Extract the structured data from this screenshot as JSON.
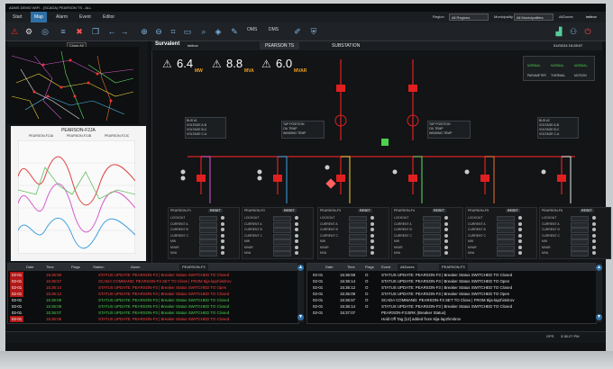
{
  "window": {
    "title": "ADMS DEMO WIFI - (SCADA) PEARSON TS - ALL"
  },
  "menu": {
    "items": [
      "Start",
      "Map",
      "Alarm",
      "Event",
      "Editor"
    ],
    "active": "Map"
  },
  "region": {
    "region_label": "Region",
    "region_value": "All Regions",
    "muni_label": "Municipality",
    "muni_value": "All Municipalities",
    "zones_label": "AllZones",
    "user": "imitrov"
  },
  "toolbar": {
    "oms_label": "OMS",
    "dms_label": "DMS"
  },
  "map": {
    "close_label": "Close All"
  },
  "trend": {
    "title": "PEARSON-F2JA",
    "legend": [
      "PEARSON-F2JA",
      "PEARSON-F2JB",
      "PEARSON-F2JC"
    ]
  },
  "dashboard": {
    "brand": "Survalent",
    "user": "imitrov",
    "station_tab": "PEARSON TS",
    "substation_tab": "SUBSTATION",
    "timestamp": "01/02/24 15:28:07",
    "kpis": [
      {
        "value": "6.4",
        "unit": "MW"
      },
      {
        "value": "8.8",
        "unit": "MVA"
      },
      {
        "value": "6.0",
        "unit": "MVAR"
      }
    ],
    "status_labels": [
      "NORMAL",
      "NORMAL",
      "NORMAL"
    ],
    "status_footer": [
      "PARAMETER",
      "THERMAL",
      "MOTION"
    ],
    "bus_left": {
      "title": "BUS #1",
      "rows": [
        "VOLTAGE A-B",
        "VOLTAGE B-C",
        "VOLTAGE C-A"
      ]
    },
    "bus_right": {
      "title": "BUS #2",
      "rows": [
        "VOLTAGE A-B",
        "VOLTAGE B-C",
        "VOLTAGE C-A"
      ]
    },
    "tx_left": {
      "rows": [
        "TAP POSITION",
        "OIL TEMP",
        "WINDING TEMP"
      ]
    },
    "tx_right": {
      "rows": [
        "TAP POSITION",
        "OIL TEMP",
        "WINDING TEMP"
      ]
    },
    "meter_rows": [
      "LOCKOUT",
      "CURRENT A",
      "CURRENT B",
      "CURRENT C",
      "MW",
      "MVAR",
      "MVA"
    ],
    "meter_titles": [
      "PEARSON-F1",
      "PEARSON-F2",
      "PEARSON-F3",
      "PEARSON-F4",
      "PEARSON-F5",
      "PEARSON-F6"
    ],
    "reset_label": "RESET"
  },
  "alarms": {
    "headers": [
      "Date",
      "Time",
      "Flags",
      "Station",
      "Alarm"
    ],
    "filter": "PEARSON-F3",
    "rows": [
      {
        "date": "02-01",
        "time": "15:36:59",
        "text": "STATUS UPDATE: PEARSON-F3  |  Breaker Status SWITCHED TO Closed",
        "color": "#ff4040"
      },
      {
        "date": "02-01",
        "time": "15:36:57",
        "text": "SCADA COMMAND: PEARSON-F3 SET TO Close  |  FROM 8ija-lap2\\imitrov",
        "color": "#ff4040"
      },
      {
        "date": "02-01",
        "time": "15:36:14",
        "text": "STATUS UPDATE: PEARSON-F3  |  Breaker Status SWITCHED TO Open",
        "color": "#ff4040"
      },
      {
        "date": "02-01",
        "time": "15:36:12",
        "text": "STATUS UPDATE: PEARSON-F3  |  Breaker Status SWITCHED TO Closed",
        "color": "#ff4040"
      },
      {
        "date": "02-01",
        "time": "15:36:09",
        "text": "STATUS UPDATE: PEARSON-F3  |  Breaker Status SWITCHED TO Closed",
        "color": "#4cd24c"
      },
      {
        "date": "02-01",
        "time": "15:36:08",
        "text": "STATUS UPDATE: PEARSON-F3  |  Breaker Status SWITCHED TO Closed",
        "color": "#4cd24c"
      },
      {
        "date": "02-01",
        "time": "15:36:07",
        "text": "STATUS UPDATE: PEARSON-F3  |  Breaker Status SWITCHED TO Closed",
        "color": "#4cd24c"
      },
      {
        "date": "02-01",
        "time": "15:36:05",
        "text": "STATUS UPDATE: PEARSON-F3  |  Breaker Status SWITCHED TO Closed",
        "color": "#ff4040"
      }
    ]
  },
  "events": {
    "headers": [
      "Date",
      "Time",
      "Flags",
      "Event"
    ],
    "zones": "AllZones",
    "filter": "PEARSON-F3",
    "rows": [
      {
        "date": "02-01",
        "time": "15:36:59",
        "flag": "O",
        "text": "STATUS UPDATE: PEARSON-F3  |  Breaker Status SWITCHED TO Closed"
      },
      {
        "date": "02-01",
        "time": "15:36:14",
        "flag": "O",
        "text": "STATUS UPDATE: PEARSON-F3  |  Breaker Status SWITCHED TO Open"
      },
      {
        "date": "02-01",
        "time": "15:36:12",
        "flag": "O",
        "text": "STATUS UPDATE: PEARSON-F3  |  Breaker Status SWITCHED TO Closed"
      },
      {
        "date": "02-01",
        "time": "15:36:09",
        "flag": "O",
        "text": "STATUS UPDATE: PEARSON-F3  |  Breaker Status SWITCHED TO Open"
      },
      {
        "date": "02-01",
        "time": "15:36:57",
        "flag": "O",
        "text": "SCADA COMMAND: PEARSON-F3 SET TO Close  |  FROM 8ija-lap2\\imitrov"
      },
      {
        "date": "02-01",
        "time": "15:36:14",
        "flag": "O",
        "text": "STATUS UPDATE: PEARSON-F3  |  Breaker Status SWITCHED TO Closed"
      },
      {
        "date": "02-01",
        "time": "15:37:07",
        "flag": "",
        "text": "PEARSON-F3.BRK (Breaker Status)"
      },
      {
        "date": "",
        "time": "",
        "flag": "",
        "text": "Hold Off Tag [12] added from 8ija-lap2\\imitrov"
      }
    ]
  },
  "status": {
    "gps": "GPS",
    "clock": "3:38:27 PM"
  },
  "colors": {
    "accent": "#2e6fa5",
    "bus": "#e02020",
    "alarm_red": "#ff4040",
    "ok_green": "#4cd24c"
  }
}
